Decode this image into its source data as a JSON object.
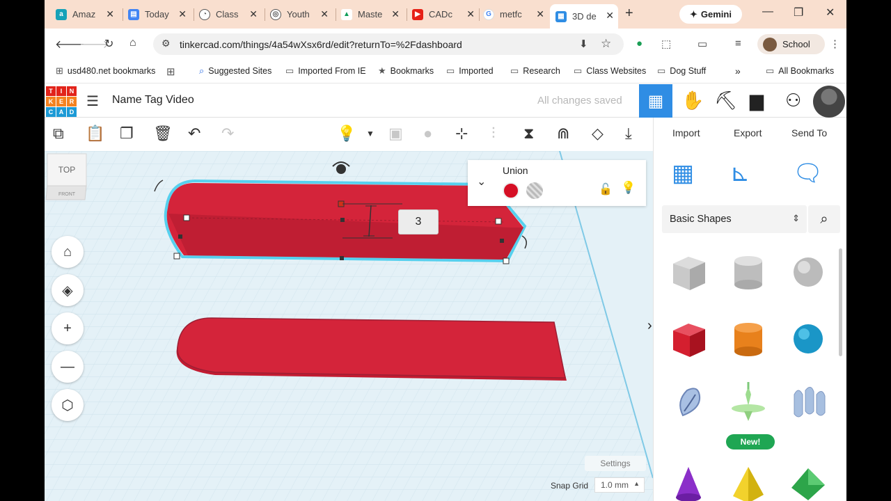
{
  "browser": {
    "tabs": [
      {
        "title": "Amaz",
        "color": "#17a2b8",
        "glyph": "a"
      },
      {
        "title": "Today",
        "color": "#4285f4",
        "glyph": "▤"
      },
      {
        "title": "Class",
        "color": "#555555",
        "glyph": "◔"
      },
      {
        "title": "Youth",
        "color": "#555555",
        "glyph": "◎"
      },
      {
        "title": "Maste",
        "color": "#0f9d58",
        "glyph": "▲"
      },
      {
        "title": "CADc",
        "color": "#e62117",
        "glyph": "▶"
      },
      {
        "title": "metfc",
        "color": "#4285f4",
        "glyph": "G"
      },
      {
        "title": "3D de",
        "color": "#2f8de4",
        "glyph": "▦"
      }
    ],
    "new_tab": "+",
    "gemini_label": "Gemini",
    "window_controls": {
      "minimize": "—",
      "maximize": "❐",
      "close": "✕"
    },
    "url": "tinkercad.com/things/4a54wXsx6rd/edit?returnTo=%2Fdashboard",
    "profile_label": "School",
    "bookmarks": [
      {
        "label": "usd480.net bookmarks",
        "icon": "⊞"
      },
      {
        "label": "",
        "icon": "⊞"
      },
      {
        "label": "Suggested Sites",
        "icon": "🔍"
      },
      {
        "label": "Imported From IE",
        "icon": "📁"
      },
      {
        "label": "Bookmarks",
        "icon": "★"
      },
      {
        "label": "Imported",
        "icon": "📁"
      },
      {
        "label": "Research",
        "icon": "📁"
      },
      {
        "label": "Class Websites",
        "icon": "📁"
      },
      {
        "label": "Dog Stuff",
        "icon": "📁"
      }
    ],
    "bookmarks_overflow": "»",
    "all_bookmarks": "All Bookmarks"
  },
  "app": {
    "logo_letters": [
      "T",
      "I",
      "N",
      "K",
      "E",
      "R",
      "C",
      "A",
      "D"
    ],
    "logo_colors": [
      "#e2231a",
      "#e2231a",
      "#e2231a",
      "#f58220",
      "#f58220",
      "#f58220",
      "#1c9ad6",
      "#1c9ad6",
      "#1c9ad6"
    ],
    "project_name": "Name Tag Video",
    "save_status": "All changes saved",
    "toolbar": {
      "import": "Import",
      "export": "Export",
      "send_to": "Send To"
    },
    "viewcube": {
      "top": "TOP",
      "front": "FRONT"
    },
    "dimension_value": "3",
    "inspector": {
      "title": "Union",
      "solid_color": "#d50f25"
    },
    "snap_grid_label": "Snap Grid",
    "snap_grid_value": "1.0 mm",
    "settings_label": "Settings",
    "shape_category": "Basic Shapes",
    "new_badge": "New!",
    "accent_color": "#2f8de4",
    "shape_color": "#d4243a"
  }
}
